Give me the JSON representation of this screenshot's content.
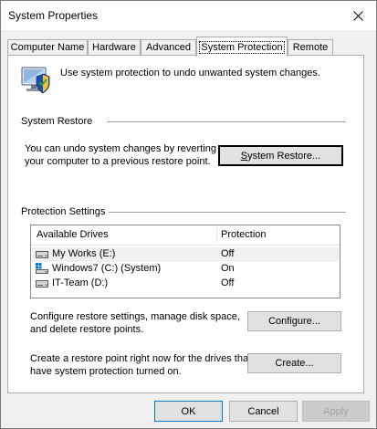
{
  "window": {
    "title": "System Properties"
  },
  "tabs": [
    {
      "label": "Computer Name"
    },
    {
      "label": "Hardware"
    },
    {
      "label": "Advanced"
    },
    {
      "label": "System Protection",
      "active": true
    },
    {
      "label": "Remote"
    }
  ],
  "intro": {
    "text": "Use system protection to undo unwanted system changes."
  },
  "system_restore": {
    "group_label": "System Restore",
    "description": [
      "You can undo system changes by reverting",
      "your computer to a previous restore point."
    ],
    "button_label": "System Restore...",
    "button_mnemonic": "S"
  },
  "protection": {
    "group_label": "Protection Settings",
    "columns": [
      "Available Drives",
      "Protection"
    ],
    "rows": [
      {
        "drive": "My Works (E:)",
        "protection": "Off",
        "icon": "drive-icon",
        "selected": true
      },
      {
        "drive": "Windows7 (C:) (System)",
        "protection": "On",
        "icon": "system-drive-icon",
        "selected": false
      },
      {
        "drive": "IT-Team (D:)",
        "protection": "Off",
        "icon": "drive-icon",
        "selected": false
      }
    ],
    "configure_text": [
      "Configure restore settings, manage disk space,",
      "and delete restore points."
    ],
    "configure_button": "Configure...",
    "create_text": [
      "Create a restore point right now for the drives that",
      "have system protection turned on."
    ],
    "create_button": "Create..."
  },
  "footer": {
    "ok": "OK",
    "cancel": "Cancel",
    "apply": "Apply"
  },
  "colors": {
    "accent_blue": "#0078d7",
    "shield_blue": "#1e4ea8",
    "drive_green": "#3c9a3c"
  }
}
